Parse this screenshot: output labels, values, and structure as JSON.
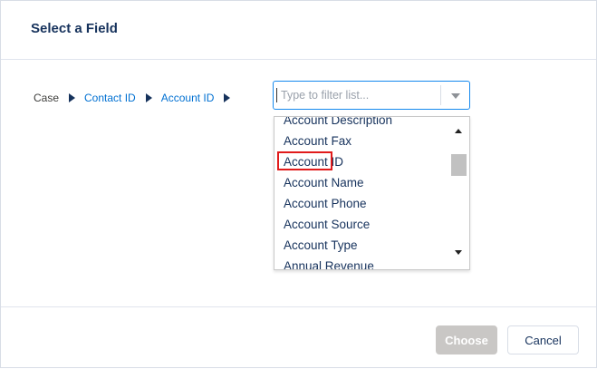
{
  "dialog": {
    "title": "Select a Field"
  },
  "breadcrumb": {
    "root": "Case",
    "links": [
      "Contact ID",
      "Account ID"
    ]
  },
  "filter": {
    "placeholder": "Type to filter list...",
    "value": ""
  },
  "options": [
    {
      "label": "Account Description",
      "selected": false
    },
    {
      "label": "Account Fax",
      "selected": false
    },
    {
      "label": "Account ID",
      "selected": true
    },
    {
      "label": "Account Name",
      "selected": false
    },
    {
      "label": "Account Phone",
      "selected": false
    },
    {
      "label": "Account Source",
      "selected": false
    },
    {
      "label": "Account Type",
      "selected": false
    },
    {
      "label": "Annual Revenue",
      "selected": false
    }
  ],
  "footer": {
    "choose_label": "Choose",
    "cancel_label": "Cancel"
  },
  "colors": {
    "link": "#0070d2",
    "focus_border": "#1589ee",
    "selection_outline": "#e11b1b",
    "disabled_button": "#c9c7c5"
  }
}
